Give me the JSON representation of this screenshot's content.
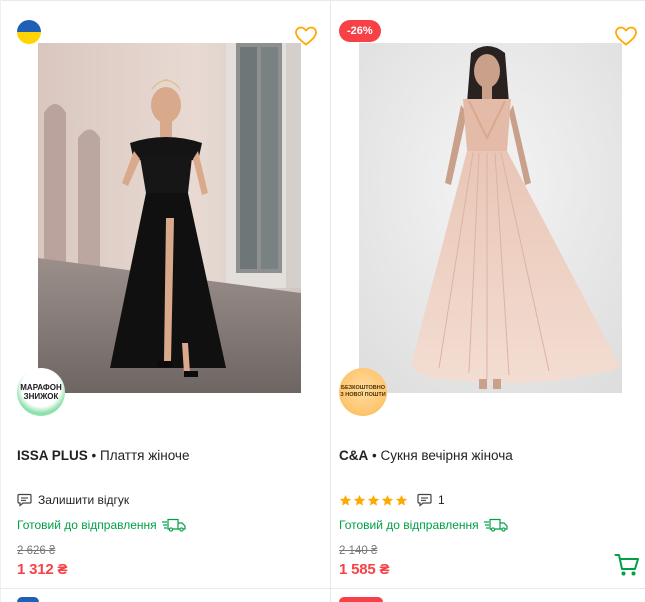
{
  "products": [
    {
      "brand": "ISSA PLUS",
      "separator": " • ",
      "name": "Плаття жіноче",
      "promo_line1": "МАРАФОН",
      "promo_line2": "ЗНИЖОК",
      "review_text": "Залишити відгук",
      "availability": "Готовий до відправлення",
      "old_price": "2 626 ₴",
      "price": "1 312 ₴",
      "badge_type": "flag-ukraine",
      "favorite_icon": "heart-outline-icon"
    },
    {
      "brand": "C&A",
      "separator": " • ",
      "name": "Сукня вечірня жіноча",
      "discount": "-26%",
      "promo_line1": "БЕЗКОШТОВНО",
      "promo_line2": "З НОВОЇ ПОШТИ",
      "rating": 5,
      "review_count": "1",
      "availability": "Готовий до відправлення",
      "old_price": "2 140 ₴",
      "price": "1 585 ₴",
      "favorite_icon": "heart-outline-icon",
      "cart_icon": "cart-icon"
    }
  ],
  "colors": {
    "accent_red": "#f84147",
    "green": "#00a046",
    "heart": "#ffa900",
    "star": "#ffa900"
  }
}
